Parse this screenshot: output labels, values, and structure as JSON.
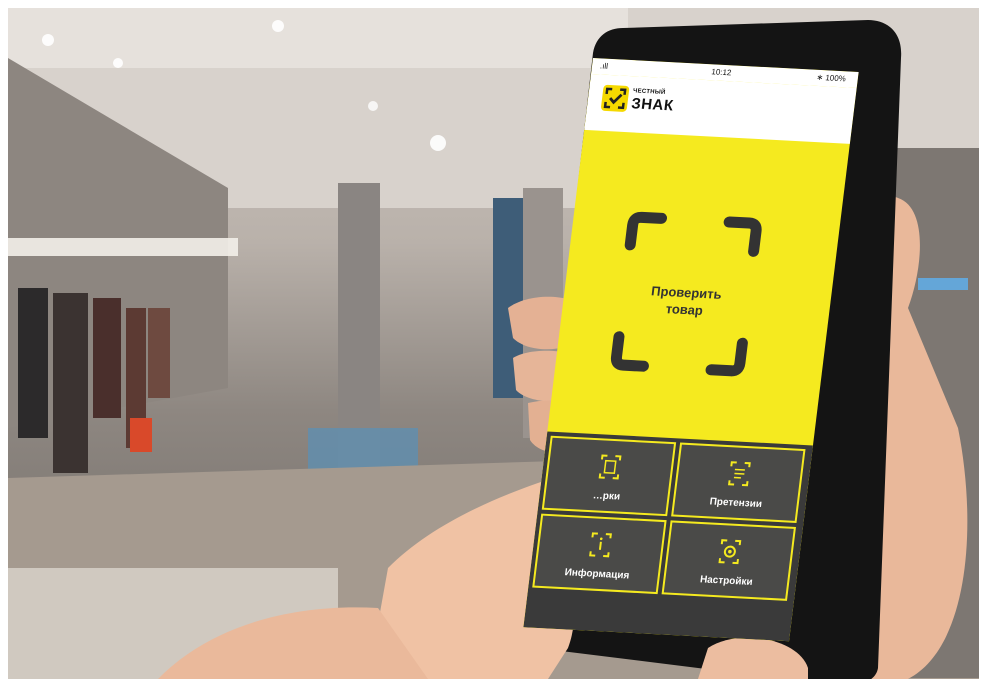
{
  "status_bar": {
    "signal": ".ıll",
    "time": "10:12",
    "battery": "∗ 100%"
  },
  "app": {
    "logo_small": "ЧЕСТНЫЙ",
    "logo_big": "ЗНАК",
    "logo_icon": "check-frame-icon"
  },
  "scan": {
    "label_line1": "Проверить",
    "label_line2": "товар",
    "icon": "scan-frame-icon"
  },
  "menu": [
    {
      "label": "…рки",
      "icon": "document-icon"
    },
    {
      "label": "Претензии",
      "icon": "document-lines-icon"
    },
    {
      "label": "Информация",
      "icon": "info-frame-icon"
    },
    {
      "label": "Настройки",
      "icon": "settings-icon"
    }
  ],
  "colors": {
    "brand_yellow": "#f5ea1f",
    "tile_dark": "#4a4a48",
    "frame_dark": "#333333"
  }
}
